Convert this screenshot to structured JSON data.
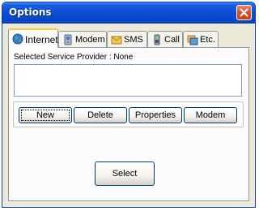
{
  "window": {
    "title": "Options"
  },
  "tabs": [
    {
      "label": "Internet",
      "icon": "globe-icon",
      "active": true
    },
    {
      "label": "Modem",
      "icon": "modem-icon",
      "active": false
    },
    {
      "label": "SMS",
      "icon": "envelope-icon",
      "active": false
    },
    {
      "label": "Call",
      "icon": "phone-icon",
      "active": false
    },
    {
      "label": "Etc.",
      "icon": "windows-icon",
      "active": false
    }
  ],
  "internet": {
    "provider_label": "Selected Service Provider : None",
    "buttons": {
      "new": "New",
      "delete": "Delete",
      "properties": "Properties",
      "modem": "Modem"
    },
    "select_label": "Select"
  },
  "colors": {
    "titlebar": "#0a4fd6",
    "dialog_bg": "#ece9d8",
    "panel_bg": "#fcfcfe",
    "active_tab_accent": "#ffc83c",
    "close_button": "#d9542e"
  }
}
